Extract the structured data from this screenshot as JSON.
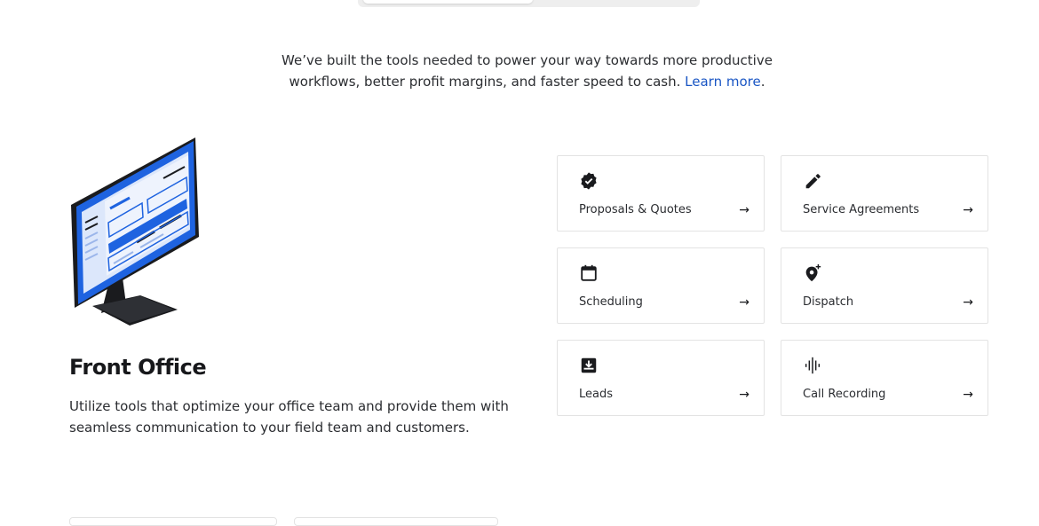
{
  "intro": {
    "line1": "We’ve built the tools needed to power your way towards more productive",
    "line2": "workflows, better profit margins, and faster speed to cash.",
    "link": "Learn more",
    "period": "."
  },
  "section": {
    "title": "Front Office",
    "description": "Utilize tools that optimize your office team and provide them with seamless communication to your field team and customers."
  },
  "cards": [
    {
      "label": "Proposals & Quotes",
      "icon": "verified-badge-icon",
      "arrow": "→"
    },
    {
      "label": "Service Agreements",
      "icon": "pencil-icon",
      "arrow": "→"
    },
    {
      "label": "Scheduling",
      "icon": "calendar-icon",
      "arrow": "→"
    },
    {
      "label": "Dispatch",
      "icon": "location-pin-add-icon",
      "arrow": "→"
    },
    {
      "label": "Leads",
      "icon": "inbox-download-icon",
      "arrow": "→"
    },
    {
      "label": "Call Recording",
      "icon": "audio-waveform-icon",
      "arrow": "→"
    }
  ],
  "colors": {
    "accent": "#1a56c4",
    "monitor_screen": "#1e63e0",
    "monitor_frame": "#1a1b1e",
    "card_border": "#e3e3e3"
  }
}
